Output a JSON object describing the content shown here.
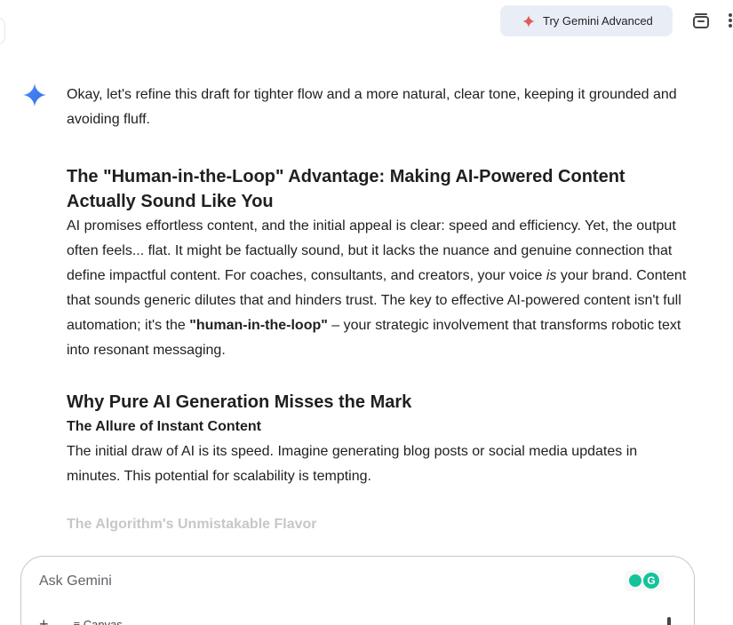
{
  "topbar": {
    "try_label": "Try Gemini Advanced"
  },
  "icons": {
    "try_spark": "sparkle-icon",
    "history": "history-icon",
    "more": "more-vert-icon",
    "assistant": "gemini-logo-icon"
  },
  "colors": {
    "spark": "#e05a5a",
    "gemini_blue": "#4285f4",
    "button_bg": "#e9eef6",
    "grammarly": "#15c39a"
  },
  "response": {
    "intro": "Okay, let's refine this draft for tighter flow and a more natural, clear tone, keeping it grounded and avoiding fluff.",
    "heading1": "The \"Human-in-the-Loop\" Advantage: Making AI-Powered Content Actually Sound Like You",
    "para1_a": "AI promises effortless content, and the initial appeal is clear: speed and efficiency. Yet, the output often feels... flat. It might be factually sound, but it lacks the nuance and genuine connection that define impactful content. For coaches, consultants, and creators, your voice ",
    "para1_em": "is",
    "para1_b": " your brand. Content that sounds generic dilutes that and hinders trust. The key to effective AI-powered content isn't full automation; it's the ",
    "para1_strong": "\"human-in-the-loop\"",
    "para1_c": " – your strategic involvement that transforms robotic text into resonant messaging.",
    "heading2": "Why Pure AI Generation Misses the Mark",
    "heading3": "The Allure of Instant Content",
    "para2": "The initial draw of AI is its speed. Imagine generating blog posts or social media updates in minutes. This potential for scalability is tempting.",
    "heading4": "The Algorithm's Unmistakable Flavor"
  },
  "input": {
    "placeholder": "Ask Gemini",
    "plus": "+",
    "canvas_label": "Canvas",
    "grammarly_letter": "G"
  }
}
